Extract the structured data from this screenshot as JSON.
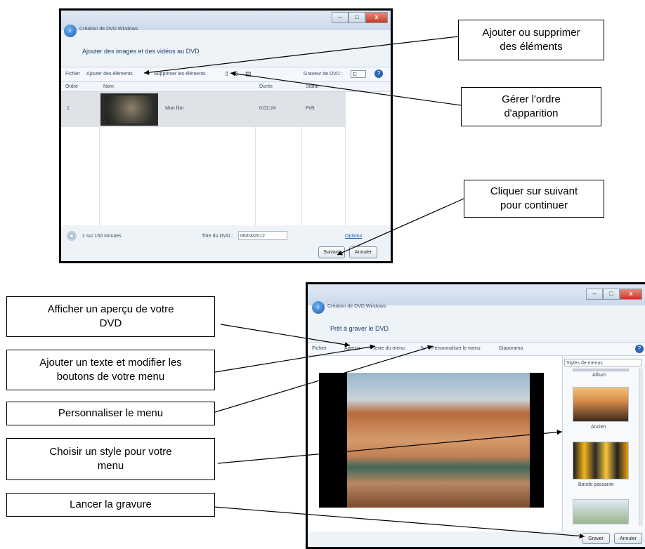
{
  "window1": {
    "title": "Création de DVD Windows",
    "subtitle": "Ajouter des images et des vidéos au DVD",
    "toolbar": {
      "file_label": "Fichier",
      "add_label": "Ajouter des éléments",
      "remove_label": "Supprimer les éléments",
      "dvd_drive_label": "Graveur de DVD :",
      "dvd_drive_value": "E:"
    },
    "columns": [
      "Ordre",
      "Nom",
      "Durée",
      "Statut"
    ],
    "rows": [
      {
        "order": "1",
        "name": "Mon film",
        "duration": "0:01:24",
        "status": "Prêt"
      }
    ],
    "footer": {
      "usage": "1 sur 150 minutes",
      "dvd_title_label": "Titre du DVD :",
      "dvd_title_value": "06/03/2012",
      "options_link": "Options"
    },
    "next_button": "Suivant",
    "cancel_button": "Annuler"
  },
  "window2": {
    "title": "Création de DVD Windows",
    "subtitle": "Prêt à graver le DVD",
    "toolbar": {
      "file_label": "Fichier",
      "preview_label": "Aperçu",
      "menu_text_label": "Texte du menu",
      "customize_label": "Personnaliser le menu",
      "slideshow_label": "Diaporama"
    },
    "menu_styles_label": "Styles de menus",
    "styles": [
      "Album",
      "Ancien",
      "Bande passante"
    ],
    "burn_button": "Graver",
    "cancel_button": "Annuler"
  },
  "callouts": {
    "add_remove": [
      "Ajouter ou supprimer",
      "des éléments"
    ],
    "order": [
      "Gérer l'ordre",
      "d'apparition"
    ],
    "next": [
      "Cliquer sur suivant",
      "pour continuer"
    ],
    "preview": [
      "Afficher un aperçu de votre",
      "DVD"
    ],
    "text_buttons": [
      "Ajouter un texte et modifier les",
      "boutons de votre menu"
    ],
    "customize": [
      "Personnaliser le menu"
    ],
    "style": [
      "Choisir un style pour votre",
      "menu"
    ],
    "burn": [
      "Lancer la gravure"
    ]
  },
  "colors": {
    "window_bg": "#eef3f8",
    "close_button": "#c63a24",
    "heading_text": "#1e3d6b"
  }
}
